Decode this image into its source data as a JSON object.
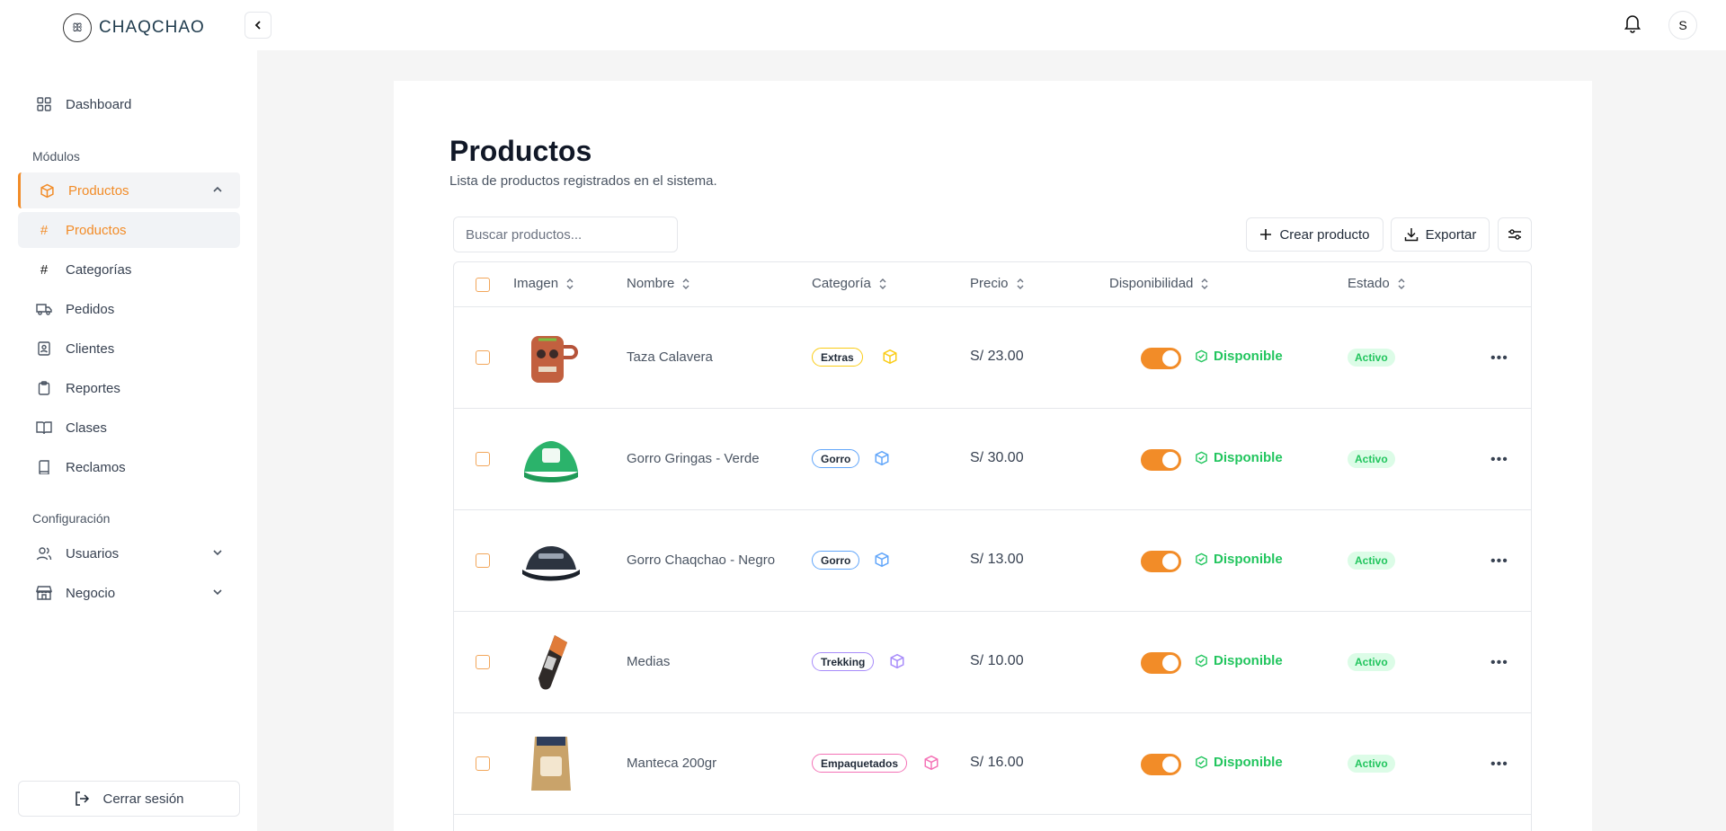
{
  "brand": {
    "name": "CHAQCHAO",
    "logo_text": "ꕥ"
  },
  "sidebar": {
    "dashboard": "Dashboard",
    "modules_label": "Módulos",
    "productos_parent": "Productos",
    "productos_child": "Productos",
    "categorias": "Categorías",
    "pedidos": "Pedidos",
    "clientes": "Clientes",
    "reportes": "Reportes",
    "clases": "Clases",
    "reclamos": "Reclamos",
    "config_label": "Configuración",
    "usuarios": "Usuarios",
    "negocio": "Negocio",
    "logout": "Cerrar sesión"
  },
  "topbar": {
    "avatar_initial": "S"
  },
  "page": {
    "title": "Productos",
    "subtitle": "Lista de productos registrados en el sistema.",
    "search_placeholder": "Buscar productos...",
    "create_label": "Crear producto",
    "export_label": "Exportar"
  },
  "table": {
    "headers": {
      "imagen": "Imagen",
      "nombre": "Nombre",
      "categoria": "Categoría",
      "precio": "Precio",
      "disponibilidad": "Disponibilidad",
      "estado": "Estado"
    },
    "rows": [
      {
        "name": "Taza Calavera",
        "category": "Extras",
        "category_color": "#facc15",
        "price": "S/ 23.00",
        "availability": "Disponible",
        "status": "Activo",
        "image": "mug"
      },
      {
        "name": "Gorro Gringas - Verde",
        "category": "Gorro",
        "category_color": "#60a5fa",
        "price": "S/ 30.00",
        "availability": "Disponible",
        "status": "Activo",
        "image": "green-cap"
      },
      {
        "name": "Gorro Chaqchao - Negro",
        "category": "Gorro",
        "category_color": "#60a5fa",
        "price": "S/ 13.00",
        "availability": "Disponible",
        "status": "Activo",
        "image": "black-cap"
      },
      {
        "name": "Medias",
        "category": "Trekking",
        "category_color": "#a78bfa",
        "price": "S/ 10.00",
        "availability": "Disponible",
        "status": "Activo",
        "image": "socks"
      },
      {
        "name": "Manteca 200gr",
        "category": "Empaquetados",
        "category_color": "#f472b6",
        "price": "S/ 16.00",
        "availability": "Disponible",
        "status": "Activo",
        "image": "bag"
      }
    ]
  },
  "colors": {
    "accent": "#f28c28",
    "success": "#22c55e"
  }
}
